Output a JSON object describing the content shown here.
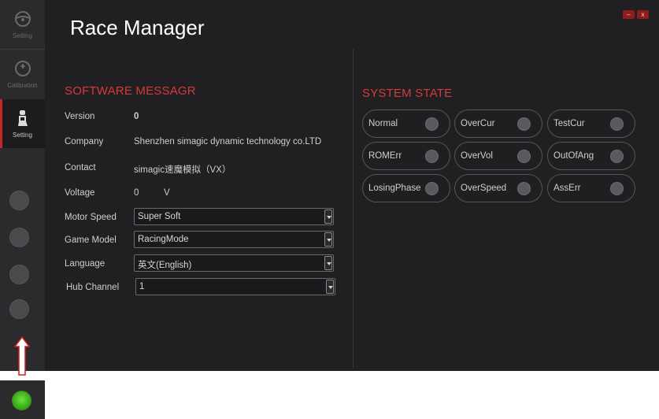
{
  "app": {
    "title": "Race Manager"
  },
  "window": {
    "minimize_label": "–",
    "close_label": "x"
  },
  "sidebar": {
    "items": [
      {
        "label": "Setting",
        "icon": "steering-wheel-icon",
        "active": false
      },
      {
        "label": "Calibration",
        "icon": "gauge-icon",
        "active": false
      },
      {
        "label": "Setting",
        "icon": "seat-icon",
        "active": true
      }
    ],
    "status_dots": 4,
    "connection_led_color": "#3fb21a"
  },
  "software": {
    "title": "SOFTWARE MESSAGR",
    "version_label": "Version",
    "version_value": "0",
    "company_label": "Company",
    "company_value": "Shenzhen simagic dynamic technology co.LTD",
    "contact_label": "Contact",
    "contact_value": "simagic速魔模拟（VX）",
    "voltage_label": "Voltage",
    "voltage_value": "0",
    "voltage_unit": "V",
    "motor_speed_label": "Motor Speed",
    "motor_speed_value": "Super Soft",
    "game_model_label": "Game Model",
    "game_model_value": "RacingMode",
    "language_label": "Language",
    "language_value": "英文(English)",
    "hub_channel_label": "Hub Channel",
    "hub_channel_value": "1"
  },
  "system_state": {
    "title": "SYSTEM STATE",
    "items": [
      {
        "label": "Normal",
        "status": "off"
      },
      {
        "label": "OverCur",
        "status": "off"
      },
      {
        "label": "TestCur",
        "status": "off"
      },
      {
        "label": "ROMErr",
        "status": "off"
      },
      {
        "label": "OverVol",
        "status": "off"
      },
      {
        "label": "OutOfAng",
        "status": "off"
      },
      {
        "label": "LosingPhase",
        "status": "off"
      },
      {
        "label": "OverSpeed",
        "status": "off"
      },
      {
        "label": "AssErr",
        "status": "off"
      }
    ]
  },
  "colors": {
    "accent": "#d63a3a",
    "background": "#202023",
    "sidebar": "#2b2b2e",
    "led_off": "#5a5a5e",
    "led_on": "#3fb21a"
  }
}
